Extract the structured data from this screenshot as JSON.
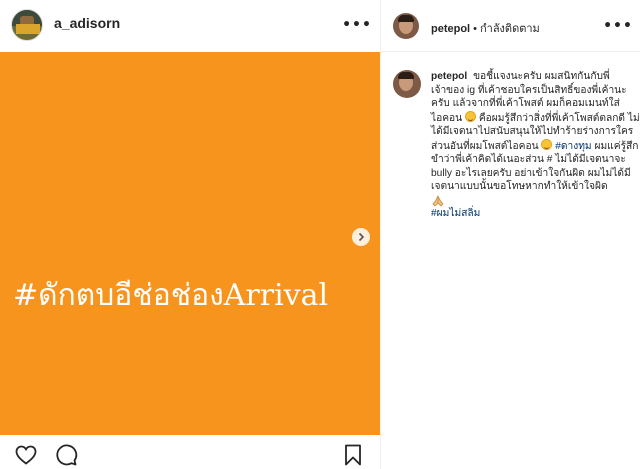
{
  "post": {
    "username": "a_adisorn",
    "image_text": "#ดักตบอีช่อช่องArrival",
    "image_bg": "#f7941d"
  },
  "comment_panel": {
    "header": {
      "username": "petepol",
      "separator": "•",
      "follow_status": "กำลังติดตาม"
    },
    "caption": {
      "username": "petepol",
      "part1": "ขอชี้แจงนะครับ ผมสนิทกันกับพี่เจ้าของ ig ที่เค้าชอบใครเป็นสิทธิ์ของพี่เค้านะครับ แล้วจากที่พี่เค้าโพสต์ ผมก็คอมเมนท์ใส่ไอคอน",
      "part2": "คือผมรู้สึกว่าสิ่งที่พี่เค้าโพสต์ตลกดี ไม่ได้มีเจตนาไปสนับสนุนให้ไปทำร้ายร่างการใคร ส่วนอันที่ผมโพสต์ไอคอน",
      "hashtag1": "#ดางทุม",
      "part3": "ผมแค่รู้สึกขำว่าพี่เค้าคิดได้เนอะส่วน # ไม่ได้มีเจตนาจะ bully อะไรเลยครับ อย่าเข้าใจกันผิด ผมไม่ได้มีเจตนาแบบนั้นขอโทษหากทำให้เข้าใจผิด",
      "hashtag2": "#ผมไม่สลิ่ม"
    }
  },
  "icons": {
    "more": "more-options-icon",
    "next": "chevron-right-icon",
    "like": "heart-icon",
    "comment": "comment-icon",
    "save": "bookmark-icon",
    "laugh": "laughing-emoji-icon",
    "pray": "folded-hands-icon"
  }
}
